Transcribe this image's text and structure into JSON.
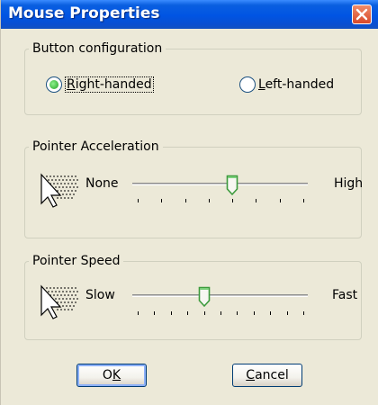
{
  "window": {
    "title": "Mouse Properties"
  },
  "button_config": {
    "legend": "Button configuration",
    "right_handed": {
      "accel": "R",
      "rest": "ight-handed",
      "checked": true
    },
    "left_handed": {
      "accel": "L",
      "rest": "eft-handed",
      "checked": false
    }
  },
  "acceleration": {
    "legend": "Pointer Acceleration",
    "min_label": "None",
    "max_label": "High",
    "ticks": 8,
    "value_index": 4
  },
  "speed": {
    "legend": "Pointer Speed",
    "min_label": "Slow",
    "max_label": "Fast",
    "ticks": 11,
    "value_index": 4
  },
  "buttons": {
    "ok": {
      "pre": "O",
      "accel": "K",
      "post": ""
    },
    "cancel": {
      "pre": "",
      "accel": "C",
      "post": "ancel"
    }
  },
  "colors": {
    "titlebar": "#0054e3",
    "dialog": "#ece9d8",
    "radio_selected": "#21a121",
    "thumb": "#3c9a3c"
  },
  "icons": [
    "close-icon",
    "pointer-acceleration-icon",
    "pointer-speed-icon",
    "slider-thumb-icon"
  ]
}
